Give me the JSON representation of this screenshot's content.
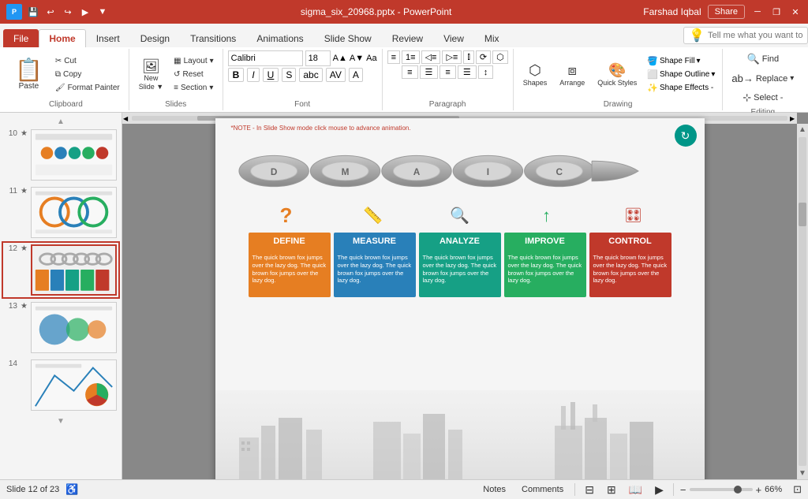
{
  "titleBar": {
    "title": "sigma_six_20968.pptx - PowerPoint",
    "user": "Farshad Iqbal",
    "shareLabel": "Share",
    "minimizeIcon": "─",
    "restoreIcon": "❐",
    "closeIcon": "✕"
  },
  "ribbon": {
    "tabs": [
      "File",
      "Home",
      "Insert",
      "Design",
      "Transitions",
      "Animations",
      "Slide Show",
      "Review",
      "View",
      "Mix"
    ],
    "activeTab": "Home",
    "tellMePlaceholder": "Tell me what you want to do...",
    "groups": {
      "clipboard": {
        "label": "Clipboard",
        "paste": "Paste",
        "cutLabel": "Cut",
        "copyLabel": "Copy",
        "formatLabel": "Format Painter"
      },
      "slides": {
        "label": "Slides",
        "newSlideLabel": "New Slide",
        "layoutLabel": "Layout",
        "resetLabel": "Reset",
        "sectionLabel": "Section"
      },
      "font": {
        "label": "Font",
        "fontName": "Calibri",
        "fontSize": "18",
        "boldLabel": "B",
        "italicLabel": "I",
        "underlineLabel": "U"
      },
      "paragraph": {
        "label": "Paragraph"
      },
      "drawing": {
        "label": "Drawing",
        "shapesLabel": "Shapes",
        "arrangeLabel": "Arrange",
        "quickStylesLabel": "Quick Styles",
        "shapeFillLabel": "Shape Fill",
        "shapeOutlineLabel": "Shape Outline",
        "shapeEffectsLabel": "Shape Effects -"
      },
      "editing": {
        "label": "Editing",
        "findLabel": "Find",
        "replaceLabel": "Replace",
        "selectLabel": "Select -"
      }
    }
  },
  "slides": [
    {
      "num": "10",
      "star": "★",
      "id": "slide-10"
    },
    {
      "num": "11",
      "star": "★",
      "id": "slide-11"
    },
    {
      "num": "12",
      "star": "★",
      "id": "slide-12",
      "active": true
    },
    {
      "num": "13",
      "star": "★",
      "id": "slide-13"
    },
    {
      "num": "14",
      "star": "",
      "id": "slide-14"
    }
  ],
  "mainSlide": {
    "noteText": "*NOTE - In Slide Show mode click mouse to advance animation.",
    "chainLetters": [
      "D",
      "M",
      "A",
      "I",
      "C"
    ],
    "dmaicIcons": [
      "?",
      "📏",
      "🔍",
      "↑",
      "🎛"
    ],
    "dmaicItems": [
      {
        "letter": "D",
        "title": "DEFINE",
        "color": "#E67E22",
        "bodyBg": "#E67E22",
        "icon": "?",
        "iconColor": "#E67E22",
        "text": "The quick brown fox jumps over the lazy dog. The quick brown fox jumps over the lazy dog."
      },
      {
        "letter": "M",
        "title": "MEASURE",
        "color": "#2980B9",
        "bodyBg": "#2980B9",
        "icon": "📏",
        "iconColor": "#2980B9",
        "text": "The quick brown fox jumps over the lazy dog. The quick brown fox jumps over the lazy dog."
      },
      {
        "letter": "A",
        "title": "ANALYZE",
        "color": "#16A085",
        "bodyBg": "#16A085",
        "icon": "🔍",
        "iconColor": "#16A085",
        "text": "The quick brown fox jumps over the lazy dog. The quick brown fox jumps over the lazy dog."
      },
      {
        "letter": "I",
        "title": "IMPROVE",
        "color": "#27AE60",
        "bodyBg": "#27AE60",
        "icon": "↑",
        "iconColor": "#27AE60",
        "text": "The quick brown fox jumps over the lazy dog. The quick brown fox jumps over the lazy dog."
      },
      {
        "letter": "C",
        "title": "CONTROL",
        "color": "#C0392B",
        "bodyBg": "#C0392B",
        "icon": "🎛",
        "iconColor": "#C0392B",
        "text": "The quick brown fox jumps over the lazy dog. The quick brown fox jumps over the lazy dog."
      }
    ]
  },
  "statusBar": {
    "slideInfo": "Slide 12 of 23",
    "notes": "Notes",
    "comments": "Comments",
    "zoomPercent": "66%"
  }
}
